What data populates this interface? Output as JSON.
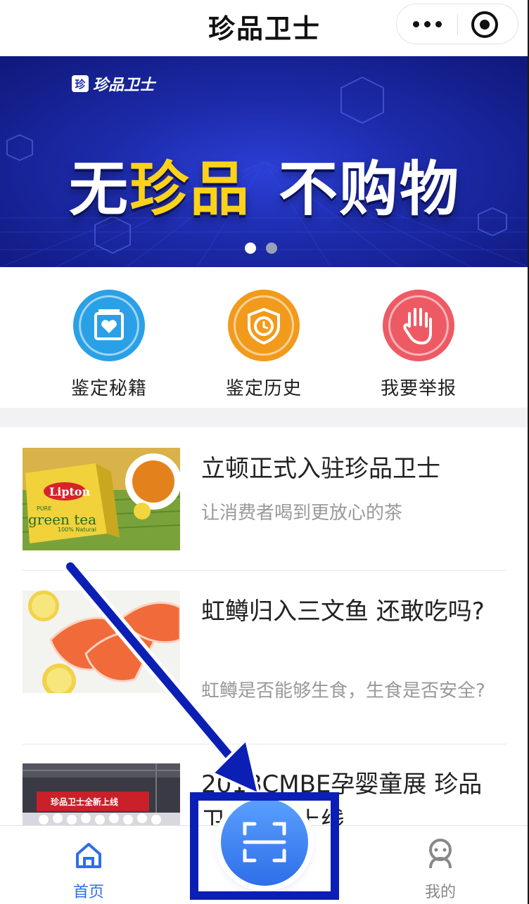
{
  "header": {
    "title": "珍品卫士",
    "more_icon": "more-dots-icon",
    "close_icon": "target-close-icon"
  },
  "banner": {
    "logo_text": "珍品卫士",
    "logo_mark": "珍",
    "slogan_part1": "无",
    "slogan_highlight": "珍品",
    "slogan_part2": "不购物",
    "slide_count": 2,
    "active_slide": 0,
    "colors": {
      "background": "#1c2aa8",
      "highlight": "#ffd21a"
    }
  },
  "quick_actions": [
    {
      "label": "鉴定秘籍",
      "icon": "book-heart-icon",
      "color": "#2aa0e6"
    },
    {
      "label": "鉴定历史",
      "icon": "clock-shield-icon",
      "color": "#f29a1b"
    },
    {
      "label": "我要举报",
      "icon": "hand-stop-icon",
      "color": "#ee5a64"
    }
  ],
  "articles": [
    {
      "title": "立顿正式入驻珍品卫士",
      "subtitle": "让消费者喝到更放心的茶",
      "thumb_brand": "Lipton",
      "thumb_text": "green tea",
      "thumb_small": "PURE",
      "thumb_small2": "100% Natural"
    },
    {
      "title": "虹鳟归入三文鱼 还敢吃吗?",
      "subtitle": "虹鳟是否能够生食，生食是否安全?"
    },
    {
      "title": "2018CMBE孕婴童展 珍品卫士全新上线",
      "subtitle": "",
      "thumb_text": "珍品卫士全新上线"
    }
  ],
  "tabbar": {
    "home_label": "首页",
    "scan_icon": "scan-icon",
    "mine_label": "我的",
    "colors": {
      "active": "#2f6ee8",
      "inactive": "#888888"
    }
  },
  "annotation": {
    "color": "#0c1fb4"
  }
}
